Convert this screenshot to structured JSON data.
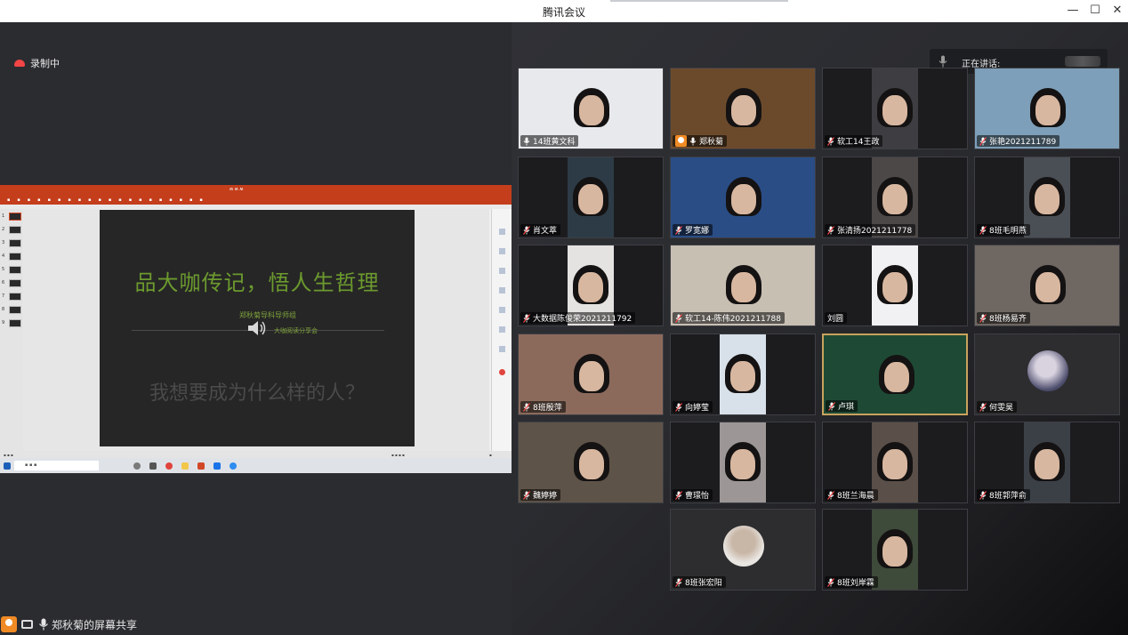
{
  "window": {
    "title": "腾讯会议",
    "minimize_glyph": "—",
    "maximize_glyph": "☐",
    "close_glyph": "✕"
  },
  "recording": {
    "label": "录制中"
  },
  "share": {
    "ppt": {
      "slide_title": "品大咖传记，悟人生哲理",
      "slide_subtitle": "郑秋菊导科导师组",
      "slide_subtitle2": "大咖阅读分享会",
      "slide_question": "我想要成为什么样的人？",
      "thumb_numbers": [
        "1",
        "2",
        "3",
        "4",
        "5",
        "6",
        "7",
        "8",
        "9"
      ]
    },
    "sharer_label": "郑秋菊的屏幕共享"
  },
  "speaking": {
    "label": "正在讲话:"
  },
  "participants": [
    {
      "name": "14班黄文科",
      "host": false,
      "bg": "#e7e9ec",
      "muted": false
    },
    {
      "name": "郑秋菊",
      "host": true,
      "bg": "#6b4a2c",
      "muted": false
    },
    {
      "name": "软工14王政",
      "host": false,
      "bg": "#3e3d41",
      "muted": true
    },
    {
      "name": "张艳2021211789",
      "host": false,
      "bg": "#7d9fb9",
      "muted": true
    },
    {
      "name": "肖文萃",
      "host": false,
      "bg": "#2d3b46",
      "muted": true
    },
    {
      "name": "罗宽娜",
      "host": false,
      "bg": "#2a4d86",
      "muted": true
    },
    {
      "name": "张清扬2021211778",
      "host": false,
      "bg": "#4c4847",
      "muted": true
    },
    {
      "name": "8班毛明燕",
      "host": false,
      "bg": "#4a4e55",
      "muted": true
    },
    {
      "name": "大数据陈俊荣2021211792",
      "host": false,
      "bg": "#e5e3e1",
      "muted": true
    },
    {
      "name": "软工14-陈伟2021211788",
      "host": false,
      "bg": "#c8bfb3",
      "muted": true
    },
    {
      "name": "刘圆",
      "host": false,
      "bg": "#f1f1f3",
      "muted": false
    },
    {
      "name": "8班杨易齐",
      "host": false,
      "bg": "#6f6761",
      "muted": true
    },
    {
      "name": "8班殷萍",
      "host": false,
      "bg": "#8b6a5c",
      "muted": true
    },
    {
      "name": "向婷莹",
      "host": false,
      "bg": "#d8e1ea",
      "muted": true
    },
    {
      "name": "卢琪",
      "host": false,
      "bg": "#1e4a35",
      "muted": true
    },
    {
      "name": "何雯昊",
      "host": false,
      "bg": "#2d2d30",
      "muted": true
    },
    {
      "name": "魏婷婷",
      "host": false,
      "bg": "#5d5348",
      "muted": true
    },
    {
      "name": "曹璟怡",
      "host": false,
      "bg": "#9c9696",
      "muted": true
    },
    {
      "name": "8班兰海晨",
      "host": false,
      "bg": "#5a4f49",
      "muted": true
    },
    {
      "name": "8班郭萍俞",
      "host": false,
      "bg": "#3b4047",
      "muted": true
    },
    {
      "name": "8班张宏阳",
      "host": false,
      "bg": "#2d2d30",
      "muted": true
    },
    {
      "name": "8班刘岸霖",
      "host": false,
      "bg": "#3e4a3a",
      "muted": true
    }
  ]
}
